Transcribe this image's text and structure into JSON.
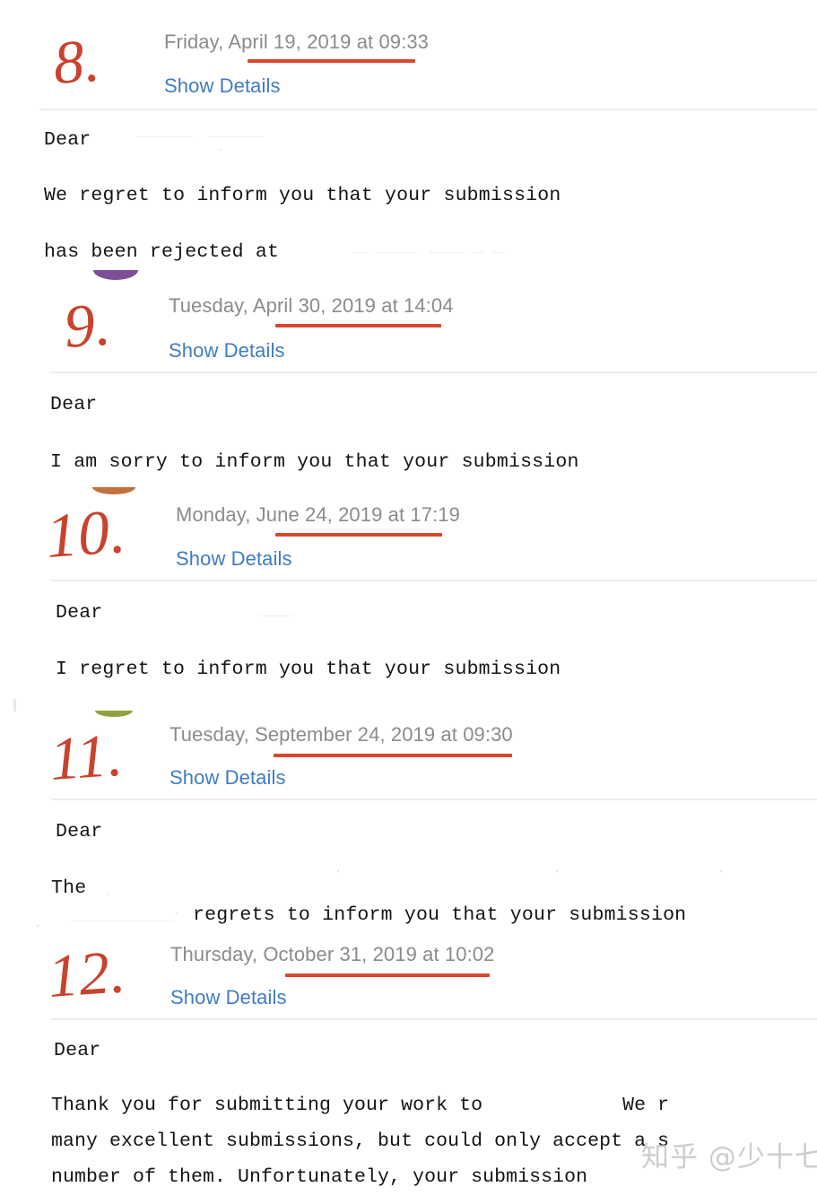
{
  "document": {
    "type": "email-thread-screenshot",
    "background_color": "#ffffff",
    "accent_colors": {
      "handwritten_number": "#c8422c",
      "date_underline": "#d9472c",
      "link": "#3f7cc0",
      "date_text": "#8b8b8b",
      "body_text": "#141414",
      "separator": "#ededee",
      "watermark": "#c9c9c9"
    }
  },
  "watermark": {
    "text": "知乎 @少十七"
  },
  "common": {
    "show_details_label": "Show Details"
  },
  "emails": [
    {
      "number": "8.",
      "date_prefix": "Friday, ",
      "date_core": "April 19, 2019",
      "date_suffix": " at 09:33",
      "full_date": "Friday, April 19, 2019 at 09:33",
      "show_details_label": "Show Details",
      "body_lines": [
        "Dear",
        "We regret to inform you that your submission",
        "has been rejected at"
      ]
    },
    {
      "number": "9.",
      "date_prefix": "Tuesday, ",
      "date_core": "April 30, 2019",
      "date_suffix": " at 14:04",
      "full_date": "Tuesday, April 30, 2019 at 14:04",
      "show_details_label": "Show Details",
      "body_lines": [
        "Dear",
        "I am sorry to inform you that your submission"
      ]
    },
    {
      "number": "10.",
      "date_prefix": "Monday, ",
      "date_core": "June 24, 2019",
      "date_suffix": " at 17:19",
      "full_date": "Monday, June 24, 2019 at 17:19",
      "show_details_label": "Show Details",
      "body_lines": [
        "Dear",
        "I regret to inform you that your submission"
      ]
    },
    {
      "number": "11.",
      "date_prefix": "Tuesday, ",
      "date_core": "September 24, 2019",
      "date_suffix": " at 09:30",
      "full_date": "Tuesday, September 24, 2019 at 09:30",
      "show_details_label": "Show Details",
      "body_lines": [
        "Dear",
        "The",
        "regrets to inform you that your submission"
      ]
    },
    {
      "number": "12.",
      "date_prefix": "Thursday, ",
      "date_core": "October 31, 2019",
      "date_suffix": " at 10:02",
      "full_date": "Thursday, October 31, 2019 at 10:02",
      "show_details_label": "Show Details",
      "body_lines": [
        "Dear",
        "Thank you for submitting your work to            We r",
        "many excellent submissions, but could only accept a s",
        "number of them. Unfortunately, your submission"
      ]
    }
  ]
}
